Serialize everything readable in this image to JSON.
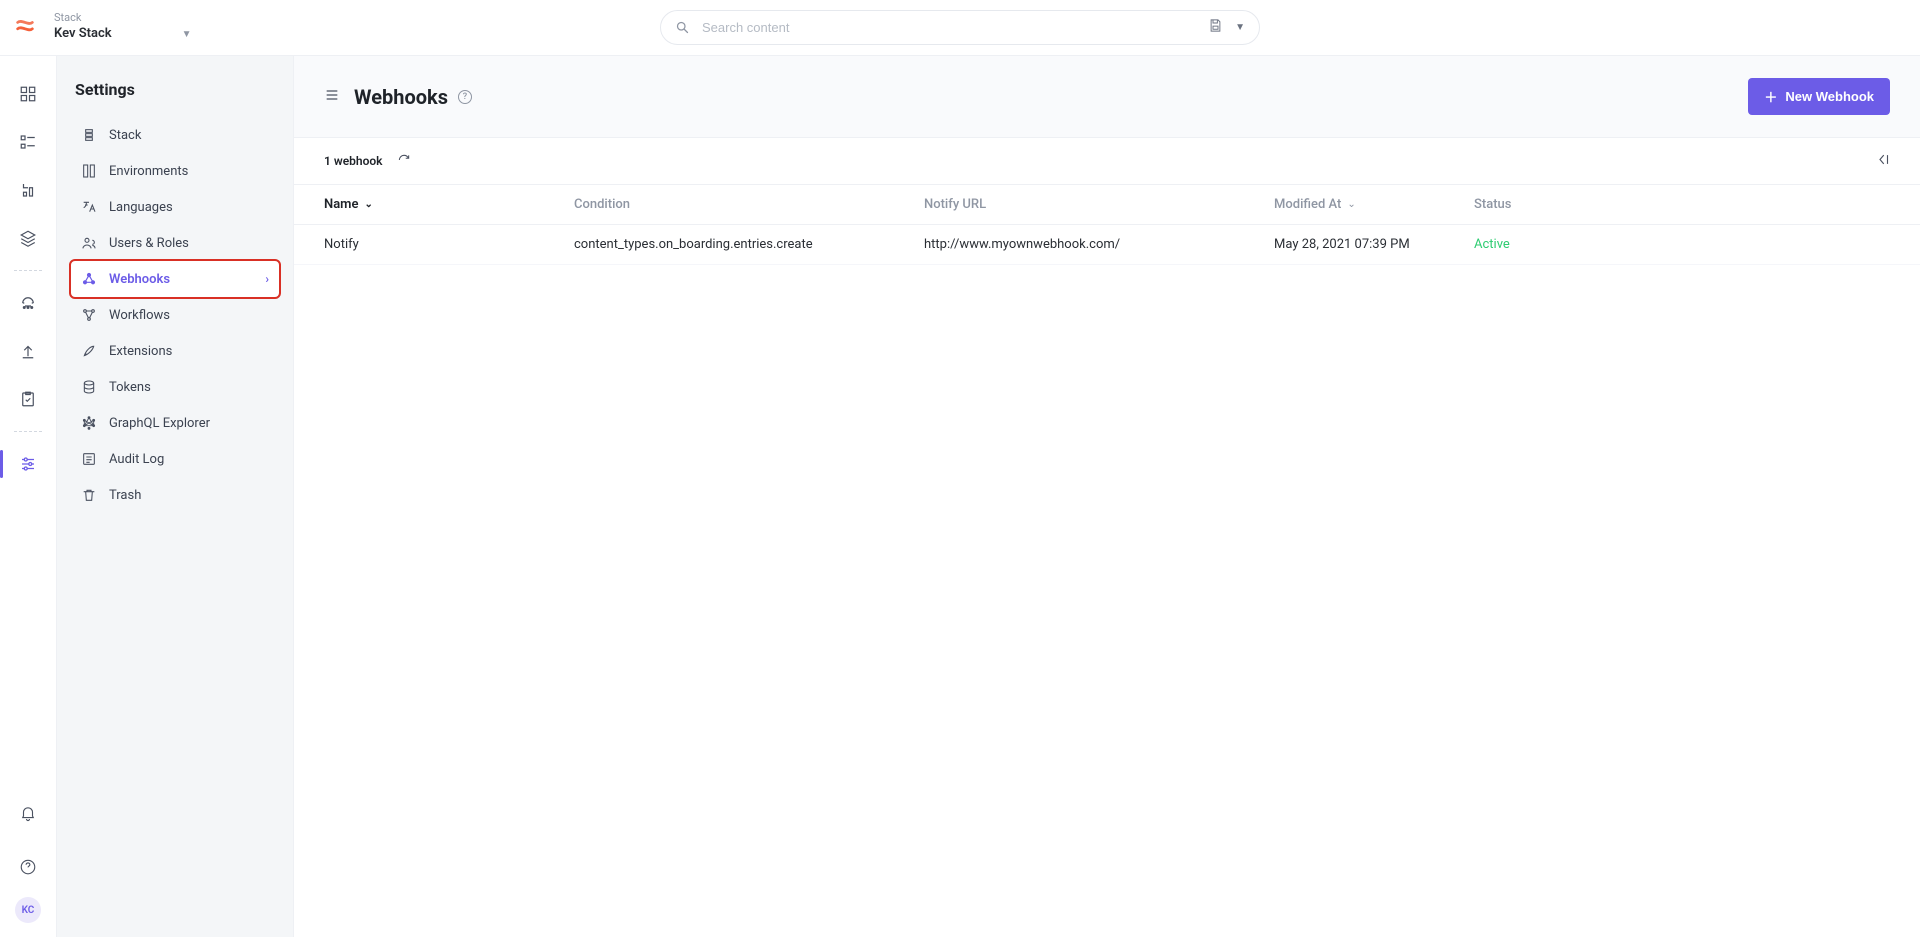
{
  "topbar": {
    "stack_label": "Stack",
    "stack_name": "Kev Stack",
    "search_placeholder": "Search content"
  },
  "rail": {
    "avatar_initials": "KC"
  },
  "sidebar": {
    "title": "Settings",
    "items": [
      {
        "label": "Stack"
      },
      {
        "label": "Environments"
      },
      {
        "label": "Languages"
      },
      {
        "label": "Users & Roles"
      },
      {
        "label": "Webhooks"
      },
      {
        "label": "Workflows"
      },
      {
        "label": "Extensions"
      },
      {
        "label": "Tokens"
      },
      {
        "label": "GraphQL Explorer"
      },
      {
        "label": "Audit Log"
      },
      {
        "label": "Trash"
      }
    ]
  },
  "page": {
    "title": "Webhooks",
    "new_button": "New Webhook",
    "count_label": "1 webhook"
  },
  "columns": {
    "name": "Name",
    "condition": "Condition",
    "notify_url": "Notify URL",
    "modified_at": "Modified At",
    "status": "Status"
  },
  "rows": [
    {
      "name": "Notify",
      "condition": "content_types.on_boarding.entries.create",
      "notify_url": "http://www.myownwebhook.com/",
      "modified_at": "May 28, 2021 07:39 PM",
      "status": "Active"
    }
  ]
}
